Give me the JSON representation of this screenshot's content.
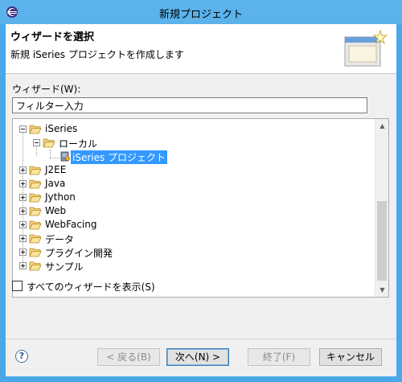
{
  "window": {
    "title": "新規プロジェクト"
  },
  "banner": {
    "heading": "ウィザードを選択",
    "description": "新規 iSeries プロジェクトを作成します"
  },
  "wizard_label": "ウィザード(W):",
  "filter": {
    "value": "フィルター入力"
  },
  "tree": {
    "items": [
      {
        "label": "iSeries",
        "expanded": true,
        "level": 0
      },
      {
        "label": "ローカル",
        "expanded": true,
        "level": 1
      },
      {
        "label": "iSeries プロジェクト",
        "level": 2,
        "selected": true
      },
      {
        "label": "J2EE",
        "expanded": false,
        "level": 0
      },
      {
        "label": "Java",
        "expanded": false,
        "level": 0
      },
      {
        "label": "Jython",
        "expanded": false,
        "level": 0
      },
      {
        "label": "Web",
        "expanded": false,
        "level": 0
      },
      {
        "label": "WebFacing",
        "expanded": false,
        "level": 0
      },
      {
        "label": "データ",
        "expanded": false,
        "level": 0
      },
      {
        "label": "プラグイン開発",
        "expanded": false,
        "level": 0
      },
      {
        "label": "サンプル",
        "expanded": false,
        "level": 0
      }
    ],
    "scroll_position": 0.8
  },
  "show_all_checkbox": {
    "label": "すべてのウィザードを表示(S)",
    "checked": false
  },
  "buttons": {
    "help": "?",
    "back": "< 戻る(B)",
    "next": "次へ(N) >",
    "finish": "終了(F)",
    "cancel": "キャンセル"
  },
  "colors": {
    "title_bar": "#5cb3ec",
    "selection": "#3399ff",
    "folder": "#e8c45a"
  },
  "icons": {
    "app": "eclipse-icon",
    "wizard_banner": "new-project-wizard-icon",
    "folder": "folder-icon",
    "project": "iseries-project-icon"
  }
}
